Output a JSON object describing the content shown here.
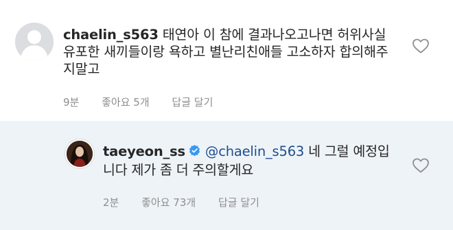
{
  "comments": [
    {
      "username": "chaelin_s563",
      "text": "태연아 이 참에 결과나오고나면 허위사실유포한 새끼들이랑 욕하고 별난리친애들 고소하자 합의해주지말고",
      "time": "9분",
      "likes": "좋아요 5개",
      "reply": "답글 달기"
    },
    {
      "username": "taeyeon_ss",
      "mention": "@chaelin_s563",
      "text": " 네 그럴 예정입니다 제가 좀 더 주의할게요",
      "time": "2분",
      "likes": "좋아요 73개",
      "reply": "답글 달기"
    }
  ],
  "icons": {
    "verified_color": "#3897f0",
    "heart": "heart-outline-icon"
  }
}
